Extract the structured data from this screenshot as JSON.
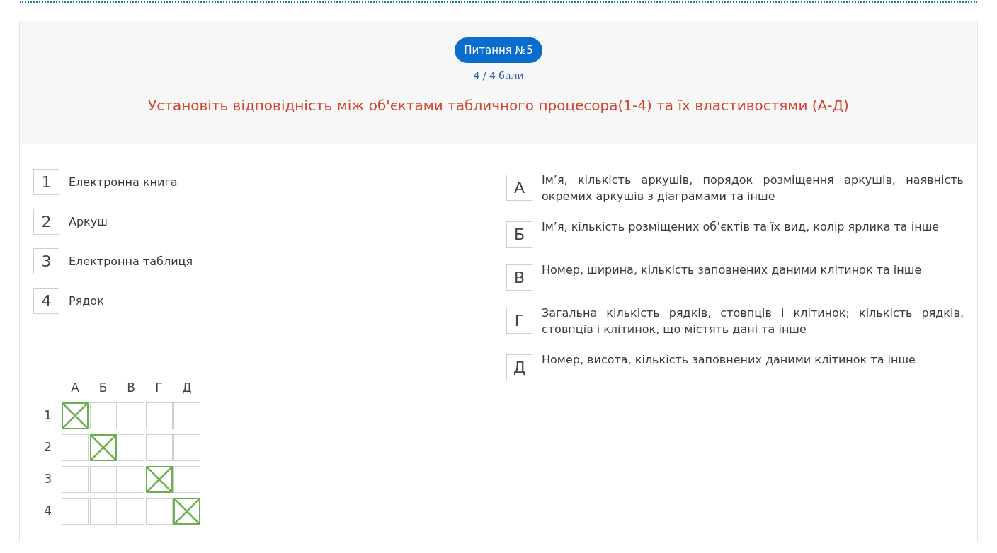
{
  "question": {
    "badge": "Питання №5",
    "score": "4 / 4 бали",
    "prompt": "Установіть відповідність між об'єктами табличного процесора(1-4) та їх властивостями (А-Д)"
  },
  "left_items": [
    {
      "key": "1",
      "text": "Електронна книга"
    },
    {
      "key": "2",
      "text": "Аркуш"
    },
    {
      "key": "3",
      "text": "Електронна таблиця"
    },
    {
      "key": "4",
      "text": "Рядок"
    }
  ],
  "right_items": [
    {
      "key": "А",
      "text": "Ім’я, кількість аркушів, порядок розміщення аркушів, наявність окремих аркушів з діаграмами та інше"
    },
    {
      "key": "Б",
      "text": "Ім’я, кількість розміщених об’єктів та їх вид, колір ярлика та інше"
    },
    {
      "key": "В",
      "text": "Номер, ширина, кількість заповнених даними клітинок та інше"
    },
    {
      "key": "Г",
      "text": "Загальна кількість рядків, стовпців і клітинок; кількість рядків, стовпців і клітинок, що містять дані та інше"
    },
    {
      "key": "Д",
      "text": "Номер, висота, кількість заповнених даними клітинок та інше"
    }
  ],
  "answer_grid": {
    "columns": [
      "А",
      "Б",
      "В",
      "Г",
      "Д"
    ],
    "rows": [
      {
        "label": "1",
        "cells": [
          {
            "checked": true
          },
          {
            "checked": false
          },
          {
            "checked": false
          },
          {
            "checked": false
          },
          {
            "checked": false
          }
        ]
      },
      {
        "label": "2",
        "cells": [
          {
            "checked": false
          },
          {
            "checked": true
          },
          {
            "checked": false
          },
          {
            "checked": false
          },
          {
            "checked": false
          }
        ]
      },
      {
        "label": "3",
        "cells": [
          {
            "checked": false
          },
          {
            "checked": false
          },
          {
            "checked": false
          },
          {
            "checked": true
          },
          {
            "checked": false
          }
        ]
      },
      {
        "label": "4",
        "cells": [
          {
            "checked": false
          },
          {
            "checked": false
          },
          {
            "checked": false
          },
          {
            "checked": false
          },
          {
            "checked": true
          }
        ]
      }
    ]
  }
}
